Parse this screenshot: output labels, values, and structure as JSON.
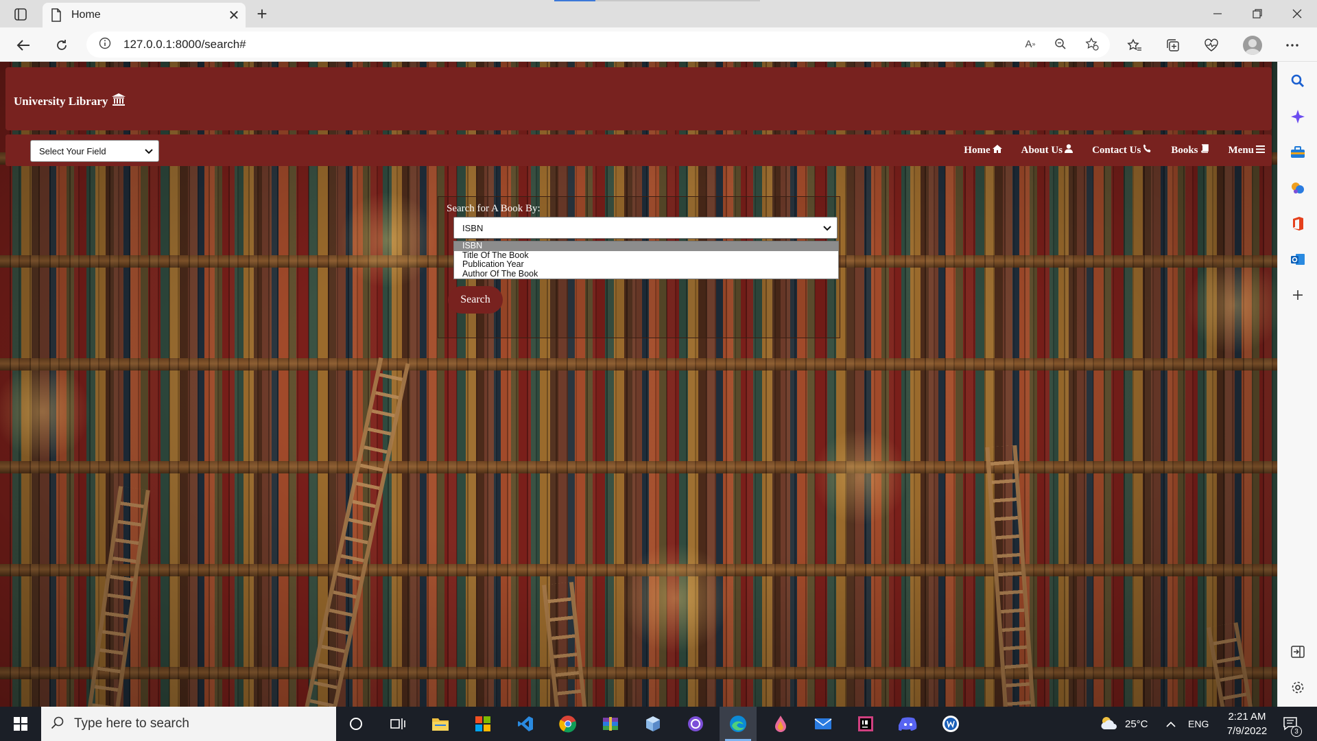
{
  "browser": {
    "tab_title": "Home",
    "url": "127.0.0.1:8000/search#",
    "new_tab_symbol": "+",
    "close_symbol": "✕",
    "icons": [
      "tab-actions-icon",
      "page-icon",
      "back-arrow-icon",
      "reload-icon",
      "site-info-icon",
      "read-aloud-icon",
      "zoom-out-icon",
      "add-favorite-icon",
      "favorites-icon",
      "collections-icon",
      "browser-essentials-icon",
      "profile-avatar-icon",
      "more-menu-icon"
    ]
  },
  "edge_sidebar": {
    "icons": [
      "search-icon",
      "copilot-icon",
      "shopping-icon",
      "games-icon",
      "office-icon",
      "outlook-icon",
      "add-icon",
      "hide-sidebar-icon",
      "settings-icon"
    ]
  },
  "site": {
    "brand": "University Library",
    "brand_icon": "bank-building-icon",
    "field_select": "Select Your Field",
    "nav": [
      {
        "label": "Home",
        "icon": "home-icon"
      },
      {
        "label": "About Us",
        "icon": "user-icon"
      },
      {
        "label": "Contact Us",
        "icon": "phone-icon"
      },
      {
        "label": "Books",
        "icon": "book-icon"
      },
      {
        "label": "Menu",
        "icon": "hamburger-icon"
      }
    ],
    "colors": {
      "brand": "#78221f"
    }
  },
  "search": {
    "label": "Search for A Book By:",
    "selected": "ISBN",
    "options": [
      "ISBN",
      "Title Of The Book",
      "Publication Year",
      "Author Of The Book"
    ],
    "button": "Search"
  },
  "taskbar": {
    "search_placeholder": "Type here to search",
    "apps": [
      "cortana-icon",
      "task-view-icon",
      "file-explorer-icon",
      "microsoft-store-icon",
      "vscode-icon",
      "chrome-icon",
      "winrar-icon",
      "box-icon",
      "github-desktop-icon",
      "edge-icon",
      "paint-drop-icon",
      "mail-icon",
      "intellij-icon",
      "discord-icon",
      "word-icon"
    ],
    "weather": "25°C",
    "lang": "ENG",
    "time": "2:21 AM",
    "date": "7/9/2022",
    "notifications": "3"
  }
}
